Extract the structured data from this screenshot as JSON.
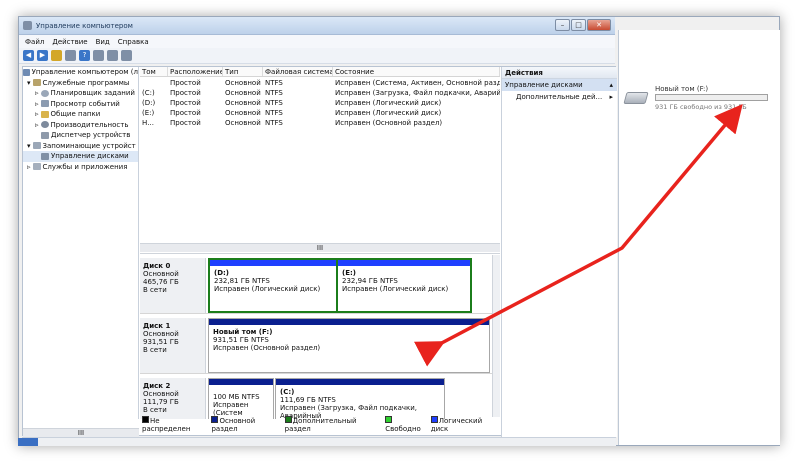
{
  "window": {
    "title": "Управление компьютером"
  },
  "menu": [
    "Файл",
    "Действие",
    "Вид",
    "Справка"
  ],
  "tree": {
    "root": "Управление компьютером (л",
    "service": "Служебные программы",
    "scheduler": "Планировщик заданий",
    "events": "Просмотр событий",
    "shared": "Общие папки",
    "perf": "Производительность",
    "devices": "Диспетчер устройств",
    "storage": "Запоминающие устройст",
    "diskmgmt": "Управление дисками",
    "services": "Службы и приложения"
  },
  "table": {
    "headers": [
      "Том",
      "Расположение",
      "Тип",
      "Файловая система",
      "Состояние"
    ],
    "rows": [
      [
        "",
        "Простой",
        "Основной",
        "NTFS",
        "Исправен (Система, Активен, Основной раздел)"
      ],
      [
        "(C:)",
        "Простой",
        "Основной",
        "NTFS",
        "Исправен (Загрузка, Файл подкачки, Аварийный"
      ],
      [
        "(D:)",
        "Простой",
        "Основной",
        "NTFS",
        "Исправен (Логический диск)"
      ],
      [
        "(E:)",
        "Простой",
        "Основной",
        "NTFS",
        "Исправен (Логический диск)"
      ],
      [
        "Н...",
        "Простой",
        "Основной",
        "NTFS",
        "Исправен (Основной раздел)"
      ]
    ]
  },
  "disks": {
    "d0": {
      "name": "Диск 0",
      "type": "Основной",
      "size": "465,76 ГБ",
      "status": "В сети",
      "p1": {
        "label": "(D:)",
        "size": "232,81 ГБ NTFS",
        "state": "Исправен (Логический диск)"
      },
      "p2": {
        "label": "(E:)",
        "size": "232,94 ГБ NTFS",
        "state": "Исправен (Логический диск)"
      }
    },
    "d1": {
      "name": "Диск 1",
      "type": "Основной",
      "size": "931,51 ГБ",
      "status": "В сети",
      "p1": {
        "label": "Новый том  (F:)",
        "size": "931,51 ГБ NTFS",
        "state": "Исправен (Основной раздел)"
      }
    },
    "d2": {
      "name": "Диск 2",
      "type": "Основной",
      "size": "111,79 ГБ",
      "status": "В сети",
      "p1": {
        "size": "100 МБ NTFS",
        "state": "Исправен (Систем"
      },
      "p2": {
        "label": "(C:)",
        "size": "111,69 ГБ NTFS",
        "state": "Исправен (Загрузка, Файл подкачки, Аварийный"
      }
    }
  },
  "legend": [
    "Не распределен",
    "Основной раздел",
    "Дополнительный раздел",
    "Свободно",
    "Логический диск"
  ],
  "legend_colors": [
    "#000000",
    "#0a1f8f",
    "#1b7d1b",
    "#2fd12f",
    "#1f3fff"
  ],
  "actions": {
    "header": "Действия",
    "item1": "Управление дисками",
    "item2": "Дополнительные дей..."
  },
  "right": {
    "title": "Новый том (F:)",
    "free": "931 ГБ свободно из 931 ГБ",
    "usage": 0
  },
  "scroll": {
    "tree": "III",
    "table": "III"
  }
}
